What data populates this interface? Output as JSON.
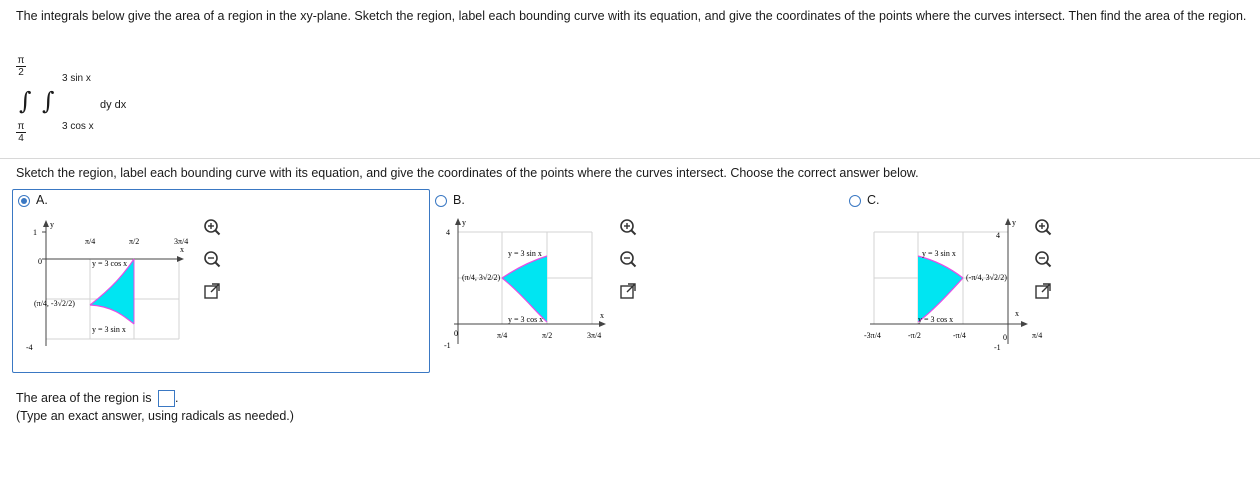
{
  "question": {
    "prompt": "The integrals below give the area of a region in the xy-plane. Sketch the region, label each bounding curve with its equation, and give the coordinates of the points where the curves intersect. Then find the area of the region.",
    "integral": {
      "outer_upper_num": "π",
      "outer_upper_den": "2",
      "outer_lower_num": "π",
      "outer_lower_den": "4",
      "inner_upper": "3 sin x",
      "inner_lower": "3 cos x",
      "integrand": "dy dx"
    },
    "subprompt": "Sketch the region, label each bounding curve with its equation, and give the coordinates of the points where the curves intersect. Choose the correct answer below."
  },
  "options": [
    {
      "letter": "A.",
      "selected": true,
      "graph": {
        "y_top": "1",
        "y_bottom": "-4",
        "x_ticks": [
          "π/4",
          "π/2",
          "3π/4"
        ],
        "axis_y": "y",
        "axis_x": "x",
        "curve_top": "y = 3 cos x",
        "curve_bottom": "y = 3 sin x",
        "point": "(π/4, -3√2/2)",
        "origin": "0"
      }
    },
    {
      "letter": "B.",
      "selected": false,
      "graph": {
        "y_top": "4",
        "y_bottom": "-1",
        "x_ticks": [
          "π/4",
          "π/2",
          "3π/4"
        ],
        "axis_y": "y",
        "axis_x": "x",
        "curve_top": "y = 3 sin x",
        "curve_bottom": "y = 3 cos x",
        "point": "(π/4, 3√2/2)",
        "origin": "0"
      }
    },
    {
      "letter": "C.",
      "selected": false,
      "graph": {
        "y_top": "4",
        "y_bottom": "-1",
        "x_ticks": [
          "-3π/4",
          "-π/2",
          "-π/4",
          "π/4"
        ],
        "axis_y": "y",
        "axis_x": "x",
        "curve_top": "y = 3 sin x",
        "curve_bottom": "y = 3 cos x",
        "point": "(-π/4, 3√2/2)",
        "origin": "0"
      }
    }
  ],
  "answer": {
    "label": "The area of the region is",
    "value": "",
    "period": ".",
    "hint": "(Type an exact answer, using radicals as needed.)"
  },
  "colors": {
    "fill": "#00e5f2",
    "curve": "#e64ce6",
    "accent": "#3a78c3"
  },
  "icons": [
    "zoom-in-icon",
    "zoom-out-icon",
    "popout-icon"
  ]
}
